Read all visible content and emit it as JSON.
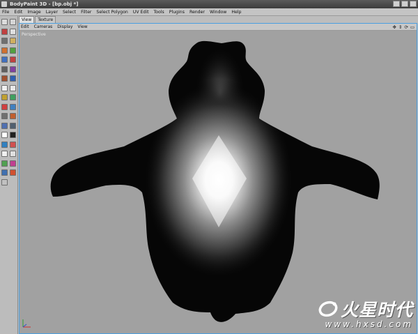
{
  "window": {
    "title": "BodyPaint 3D - [bp.obj *]"
  },
  "menubar": {
    "items": [
      "File",
      "Edit",
      "Image",
      "Layer",
      "Select",
      "Filter",
      "Select Polygon",
      "UV Edit",
      "Tools",
      "Plugins",
      "Render",
      "Window",
      "Help"
    ]
  },
  "tabs": [
    {
      "label": "View",
      "active": true
    },
    {
      "label": "Texture",
      "active": false
    }
  ],
  "viewport": {
    "menu": [
      "Edit",
      "Cameras",
      "Display",
      "View"
    ],
    "nav_icons": [
      "move-view-icon",
      "zoom-view-icon",
      "rotate-view-icon",
      "toggle-view-icon"
    ],
    "label": "Perspective"
  },
  "toolbar": {
    "tools": [
      {
        "icon": "undo-icon",
        "color": "#dcdcdc"
      },
      {
        "icon": "redo-icon",
        "color": "#d6d6d6"
      },
      {
        "icon": "magnet-icon",
        "color": "#c04040"
      },
      {
        "icon": "arrow-icon",
        "color": "#e0e0e0"
      },
      {
        "icon": "camera-icon",
        "color": "#707070"
      },
      {
        "icon": "pen-icon",
        "color": "#d0b060"
      },
      {
        "icon": "sphere-icon",
        "color": "#d07030"
      },
      {
        "icon": "brush-icon",
        "color": "#50a040"
      },
      {
        "icon": "select-live-icon",
        "color": "#4070c0"
      },
      {
        "icon": "select-rect-icon",
        "color": "#c04040"
      },
      {
        "icon": "lasso-icon",
        "color": "#606060"
      },
      {
        "icon": "magic-wand-icon",
        "color": "#8040a0"
      },
      {
        "icon": "stamp-icon",
        "color": "#a05030"
      },
      {
        "icon": "smear-icon",
        "color": "#3060b0"
      },
      {
        "icon": "checker-icon",
        "color": "#f0f0f0"
      },
      {
        "icon": "eraser-icon",
        "color": "#e8e8e8"
      },
      {
        "icon": "fill-icon",
        "color": "#c0a030"
      },
      {
        "icon": "gradient-icon",
        "color": "#40a060"
      },
      {
        "icon": "eyedropper-icon",
        "color": "#d04040"
      },
      {
        "icon": "dodge-icon",
        "color": "#4080c0"
      },
      {
        "icon": "burn-icon",
        "color": "#707070"
      },
      {
        "icon": "sponge-icon",
        "color": "#c06030"
      },
      {
        "icon": "blur-icon",
        "color": "#5070b0"
      },
      {
        "icon": "sharpen-icon",
        "color": "#506070"
      },
      {
        "icon": "color-swatch-icon",
        "color": "#ffffff"
      },
      {
        "icon": "color-swatch-bg-icon",
        "color": "#202020"
      },
      {
        "icon": "projection-icon",
        "color": "#3080c0"
      },
      {
        "icon": "layer-icon",
        "color": "#d05050"
      },
      {
        "icon": "checker-small-icon",
        "color": "#f0f0f0"
      },
      {
        "icon": "checker-icon-2",
        "color": "#e0e0e0"
      },
      {
        "icon": "uv-icon",
        "color": "#50a050"
      },
      {
        "icon": "material-icon",
        "color": "#c04090"
      },
      {
        "icon": "settings-icon",
        "color": "#4070b0"
      },
      {
        "icon": "target-icon",
        "color": "#d05030"
      },
      {
        "icon": "render-icon",
        "color": "#c0c0c0"
      }
    ]
  },
  "watermark": {
    "cn": "火星时代",
    "url": "www.hxsd.com"
  },
  "colors": {
    "viewport_border": "#4a9fe0",
    "viewport_bg": "#a1a1a1"
  }
}
